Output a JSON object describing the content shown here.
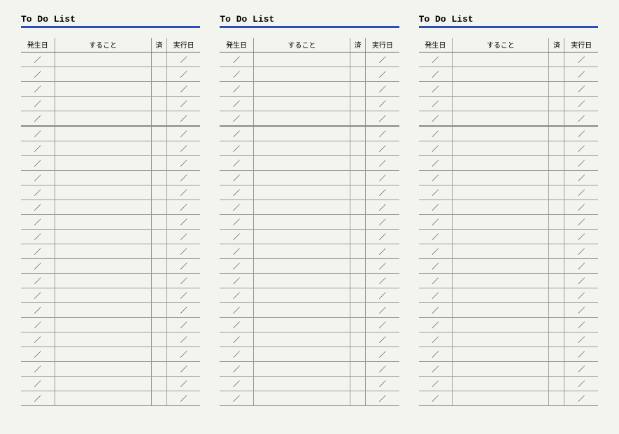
{
  "title": "To Do List",
  "headers": {
    "date1": "発生日",
    "task": "すること",
    "done": "済",
    "date2": "実行日"
  },
  "slash": "／",
  "panels": 3,
  "rows_per_panel": 24,
  "group_breaks": [
    5
  ]
}
